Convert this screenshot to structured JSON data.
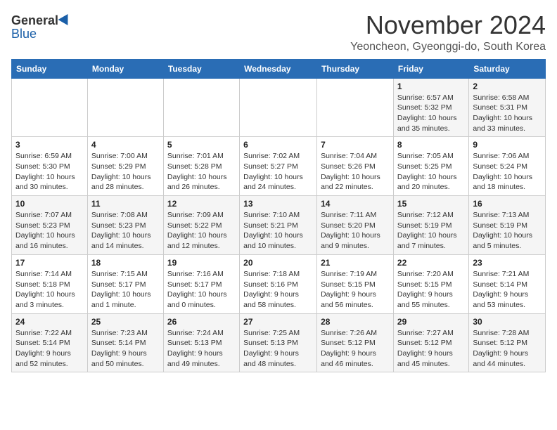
{
  "header": {
    "logo_general": "General",
    "logo_blue": "Blue",
    "month": "November 2024",
    "location": "Yeoncheon, Gyeonggi-do, South Korea"
  },
  "weekdays": [
    "Sunday",
    "Monday",
    "Tuesday",
    "Wednesday",
    "Thursday",
    "Friday",
    "Saturday"
  ],
  "weeks": [
    [
      {
        "day": "",
        "info": ""
      },
      {
        "day": "",
        "info": ""
      },
      {
        "day": "",
        "info": ""
      },
      {
        "day": "",
        "info": ""
      },
      {
        "day": "",
        "info": ""
      },
      {
        "day": "1",
        "info": "Sunrise: 6:57 AM\nSunset: 5:32 PM\nDaylight: 10 hours and 35 minutes."
      },
      {
        "day": "2",
        "info": "Sunrise: 6:58 AM\nSunset: 5:31 PM\nDaylight: 10 hours and 33 minutes."
      }
    ],
    [
      {
        "day": "3",
        "info": "Sunrise: 6:59 AM\nSunset: 5:30 PM\nDaylight: 10 hours and 30 minutes."
      },
      {
        "day": "4",
        "info": "Sunrise: 7:00 AM\nSunset: 5:29 PM\nDaylight: 10 hours and 28 minutes."
      },
      {
        "day": "5",
        "info": "Sunrise: 7:01 AM\nSunset: 5:28 PM\nDaylight: 10 hours and 26 minutes."
      },
      {
        "day": "6",
        "info": "Sunrise: 7:02 AM\nSunset: 5:27 PM\nDaylight: 10 hours and 24 minutes."
      },
      {
        "day": "7",
        "info": "Sunrise: 7:04 AM\nSunset: 5:26 PM\nDaylight: 10 hours and 22 minutes."
      },
      {
        "day": "8",
        "info": "Sunrise: 7:05 AM\nSunset: 5:25 PM\nDaylight: 10 hours and 20 minutes."
      },
      {
        "day": "9",
        "info": "Sunrise: 7:06 AM\nSunset: 5:24 PM\nDaylight: 10 hours and 18 minutes."
      }
    ],
    [
      {
        "day": "10",
        "info": "Sunrise: 7:07 AM\nSunset: 5:23 PM\nDaylight: 10 hours and 16 minutes."
      },
      {
        "day": "11",
        "info": "Sunrise: 7:08 AM\nSunset: 5:23 PM\nDaylight: 10 hours and 14 minutes."
      },
      {
        "day": "12",
        "info": "Sunrise: 7:09 AM\nSunset: 5:22 PM\nDaylight: 10 hours and 12 minutes."
      },
      {
        "day": "13",
        "info": "Sunrise: 7:10 AM\nSunset: 5:21 PM\nDaylight: 10 hours and 10 minutes."
      },
      {
        "day": "14",
        "info": "Sunrise: 7:11 AM\nSunset: 5:20 PM\nDaylight: 10 hours and 9 minutes."
      },
      {
        "day": "15",
        "info": "Sunrise: 7:12 AM\nSunset: 5:19 PM\nDaylight: 10 hours and 7 minutes."
      },
      {
        "day": "16",
        "info": "Sunrise: 7:13 AM\nSunset: 5:19 PM\nDaylight: 10 hours and 5 minutes."
      }
    ],
    [
      {
        "day": "17",
        "info": "Sunrise: 7:14 AM\nSunset: 5:18 PM\nDaylight: 10 hours and 3 minutes."
      },
      {
        "day": "18",
        "info": "Sunrise: 7:15 AM\nSunset: 5:17 PM\nDaylight: 10 hours and 1 minute."
      },
      {
        "day": "19",
        "info": "Sunrise: 7:16 AM\nSunset: 5:17 PM\nDaylight: 10 hours and 0 minutes."
      },
      {
        "day": "20",
        "info": "Sunrise: 7:18 AM\nSunset: 5:16 PM\nDaylight: 9 hours and 58 minutes."
      },
      {
        "day": "21",
        "info": "Sunrise: 7:19 AM\nSunset: 5:15 PM\nDaylight: 9 hours and 56 minutes."
      },
      {
        "day": "22",
        "info": "Sunrise: 7:20 AM\nSunset: 5:15 PM\nDaylight: 9 hours and 55 minutes."
      },
      {
        "day": "23",
        "info": "Sunrise: 7:21 AM\nSunset: 5:14 PM\nDaylight: 9 hours and 53 minutes."
      }
    ],
    [
      {
        "day": "24",
        "info": "Sunrise: 7:22 AM\nSunset: 5:14 PM\nDaylight: 9 hours and 52 minutes."
      },
      {
        "day": "25",
        "info": "Sunrise: 7:23 AM\nSunset: 5:14 PM\nDaylight: 9 hours and 50 minutes."
      },
      {
        "day": "26",
        "info": "Sunrise: 7:24 AM\nSunset: 5:13 PM\nDaylight: 9 hours and 49 minutes."
      },
      {
        "day": "27",
        "info": "Sunrise: 7:25 AM\nSunset: 5:13 PM\nDaylight: 9 hours and 48 minutes."
      },
      {
        "day": "28",
        "info": "Sunrise: 7:26 AM\nSunset: 5:12 PM\nDaylight: 9 hours and 46 minutes."
      },
      {
        "day": "29",
        "info": "Sunrise: 7:27 AM\nSunset: 5:12 PM\nDaylight: 9 hours and 45 minutes."
      },
      {
        "day": "30",
        "info": "Sunrise: 7:28 AM\nSunset: 5:12 PM\nDaylight: 9 hours and 44 minutes."
      }
    ]
  ]
}
